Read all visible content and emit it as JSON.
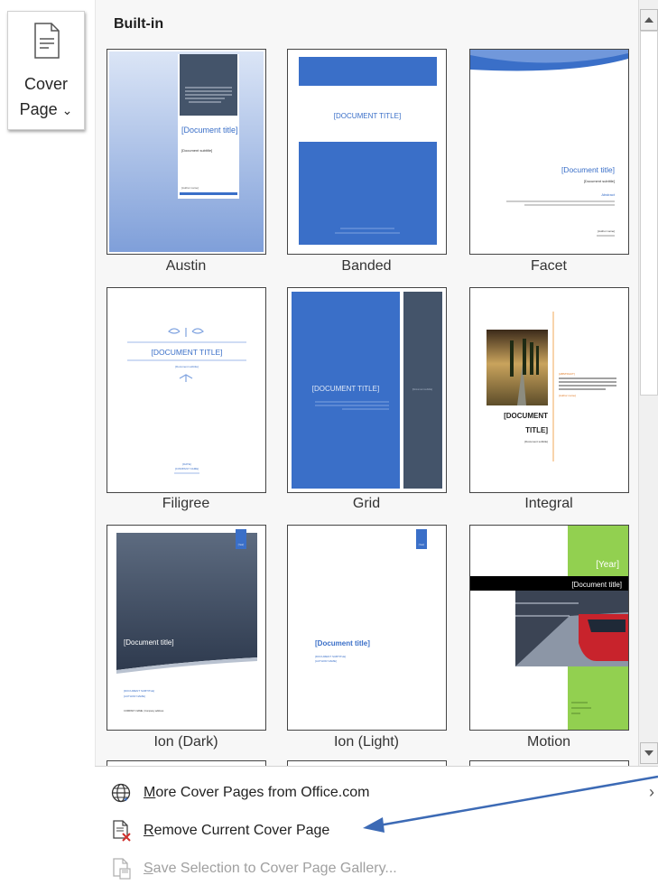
{
  "ribbon_button": {
    "line1": "Cover",
    "line2": "Page",
    "chevron": "⌄"
  },
  "gallery": {
    "heading": "Built-in",
    "templates": [
      {
        "name": "Austin",
        "title": "[Document title]",
        "subtitle": "[Document subtitle]",
        "author": "[Author name]"
      },
      {
        "name": "Banded",
        "title": "[DOCUMENT TITLE]"
      },
      {
        "name": "Facet",
        "title": "[Document title]",
        "subtitle": "[Document subtitle]",
        "abstract_label": "Abstract",
        "author": "[Author name]"
      },
      {
        "name": "Filigree",
        "title": "[DOCUMENT TITLE]",
        "subtitle": "[Document subtitle]",
        "date": "[DATE]",
        "company": "[COMPANY NAME]"
      },
      {
        "name": "Grid",
        "title": "[DOCUMENT TITLE]",
        "side": "[Document subtitle]"
      },
      {
        "name": "Integral",
        "title_line1": "[DOCUMENT",
        "title_line2": "TITLE]",
        "subtitle": "[Document subtitle]",
        "abstract_label": "[ABSTRACT]",
        "author": "[Author name]"
      },
      {
        "name": "Ion (Dark)",
        "title": "[Document title]",
        "year": "[Year]",
        "subtitle": "[DOCUMENT SUBTITLE]",
        "author": "[AUTHOR NAME]",
        "company": "COMPANY NAME | Company address"
      },
      {
        "name": "Ion (Light)",
        "title": "[Document title]",
        "year": "[Year]",
        "subtitle": "[DOCUMENT SUBTITLE]",
        "author": "[AUTHOR NAME]"
      },
      {
        "name": "Motion",
        "year": "[Year]",
        "title": "[Document title]"
      }
    ]
  },
  "menu": {
    "more": {
      "prefix": "M",
      "label": "ore Cover Pages from Office.com",
      "chevron": "›"
    },
    "remove": {
      "prefix": "R",
      "label": "emove Current Cover Page"
    },
    "save": {
      "prefix": "S",
      "label": "ave Selection to Cover Page Gallery..."
    }
  },
  "colors": {
    "accent_blue": "#3a6fc8",
    "slate": "#44546a",
    "motion_green": "#92d050",
    "arrow": "#3c6ab5"
  },
  "icons": [
    "document-icon",
    "globe-icon",
    "remove-page-icon",
    "save-page-icon",
    "scroll-up-icon",
    "scroll-down-icon",
    "chevron-right-icon"
  ]
}
